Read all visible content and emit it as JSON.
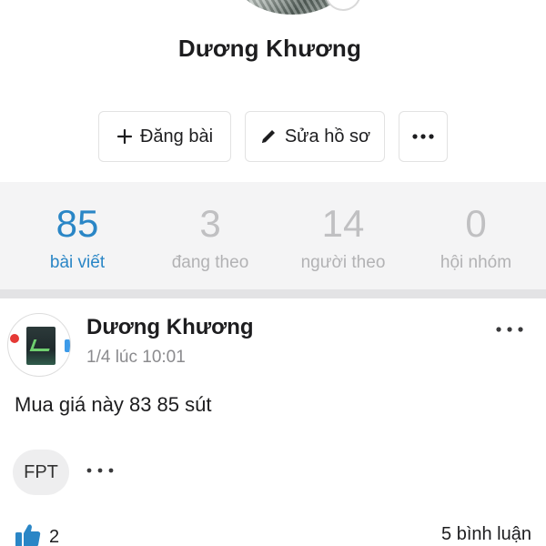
{
  "profile": {
    "name": "Dương Khương"
  },
  "actions": {
    "post_label": "Đăng bài",
    "edit_label": "Sửa hồ sơ",
    "more_icon": "more-horizontal-icon"
  },
  "stats": [
    {
      "value": "85",
      "label": "bài viết",
      "active": true
    },
    {
      "value": "3",
      "label": "đang theo",
      "active": false
    },
    {
      "value": "14",
      "label": "người theo",
      "active": false
    },
    {
      "value": "0",
      "label": "hội nhóm",
      "active": false
    }
  ],
  "post": {
    "author": "Dương Khương",
    "timestamp": "1/4 lúc 10:01",
    "text": "Mua giá này 83 85 sút",
    "tag": "FPT",
    "likes": "2",
    "comments": "5 bình luận"
  },
  "colors": {
    "accent": "#2a86c6",
    "stat_inactive": "#c0c0c2",
    "stats_background": "#f4f4f5",
    "like_icon": "#2a86c6"
  }
}
